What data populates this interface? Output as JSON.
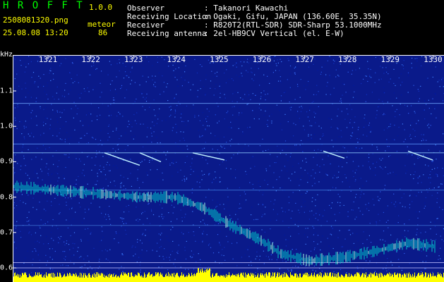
{
  "header": {
    "app_name": "H R O F F T",
    "version": "1.0.0",
    "filename": "2508081320.png",
    "datetime": "25.08.08 13:20",
    "count_label": "meteor",
    "count_value": "86",
    "fields": [
      {
        "label": "Observer",
        "value": ": Takanori Kawachi"
      },
      {
        "label": "Receiving Location",
        "value": ": Ogaki, Gifu, JAPAN (136.60E, 35.35N)"
      },
      {
        "label": "Receiver",
        "value": ": R820T2(RTL-SDR) SDR-Sharp 53.1000MHz"
      },
      {
        "label": "Receiving antenna",
        "value": ": 2el-HB9CV Vertical (el. E-W)"
      }
    ]
  },
  "axes": {
    "y_unit": "kHz",
    "y_ticks": [
      "1.1",
      "1.0",
      "0.9",
      "0.8",
      "0.7",
      "0.6"
    ],
    "x_ticks": [
      "1321",
      "1322",
      "1323",
      "1324",
      "1325",
      "1326",
      "1327",
      "1328",
      "1329",
      "1330"
    ]
  },
  "colors": {
    "background": "#000000",
    "plot_noise": "#0a1a8a",
    "signal": "#00c8c8",
    "strong_signal": "#ffff00",
    "label": "#ffffff",
    "highlight": "#ffff00",
    "app_name": "#00ff00"
  }
}
